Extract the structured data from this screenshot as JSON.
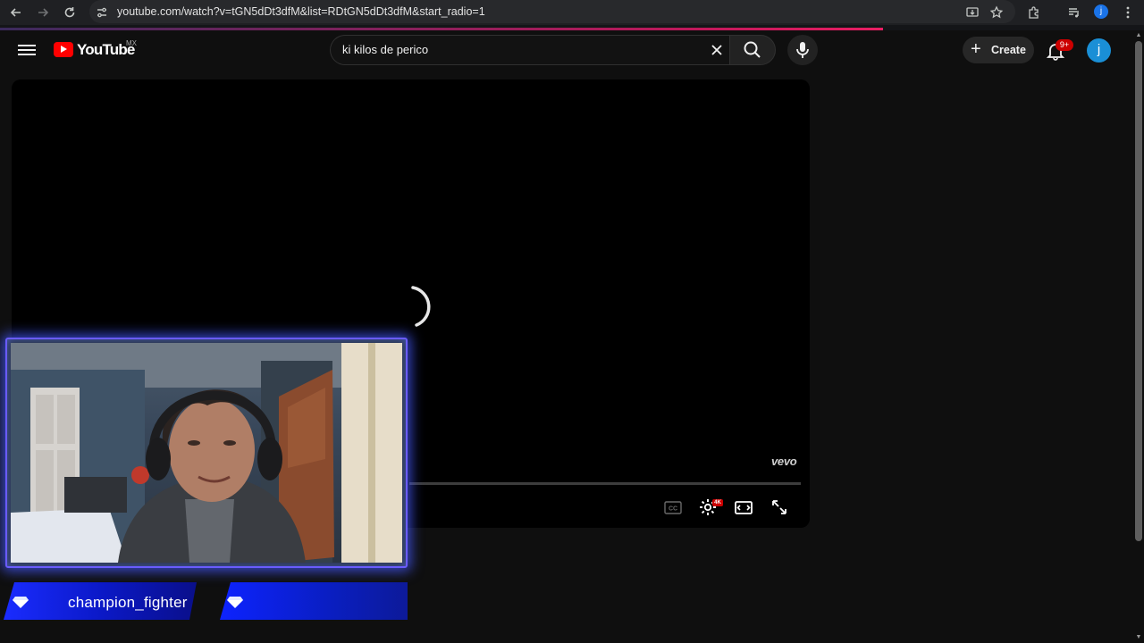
{
  "browser": {
    "url": "youtube.com/watch?v=tGN5dDt3dfM&list=RDtGN5dDt3dfM&start_radio=1",
    "profile_initial": "j",
    "icons": [
      "back-arrow-icon",
      "forward-arrow-icon",
      "reload-icon",
      "site-settings-icon",
      "install-app-icon",
      "bookmark-star-icon",
      "extensions-icon",
      "media-controls-icon",
      "chrome-menu-icon"
    ]
  },
  "youtube": {
    "logo_text": "YouTube",
    "country_code": "MX",
    "search_query": "ki kilos de perico",
    "create_label": "Create",
    "notification_badge": "9+",
    "avatar_initial": "j",
    "accent_color": "#ff0000"
  },
  "player": {
    "watermark": "vevo",
    "quality_badge": "4K",
    "controls": [
      "subtitles-icon",
      "settings-icon",
      "theater-mode-icon",
      "fullscreen-icon"
    ]
  },
  "webcam_overlay": {
    "username": "champion_fighter",
    "frame_color": "#3b4bff"
  }
}
